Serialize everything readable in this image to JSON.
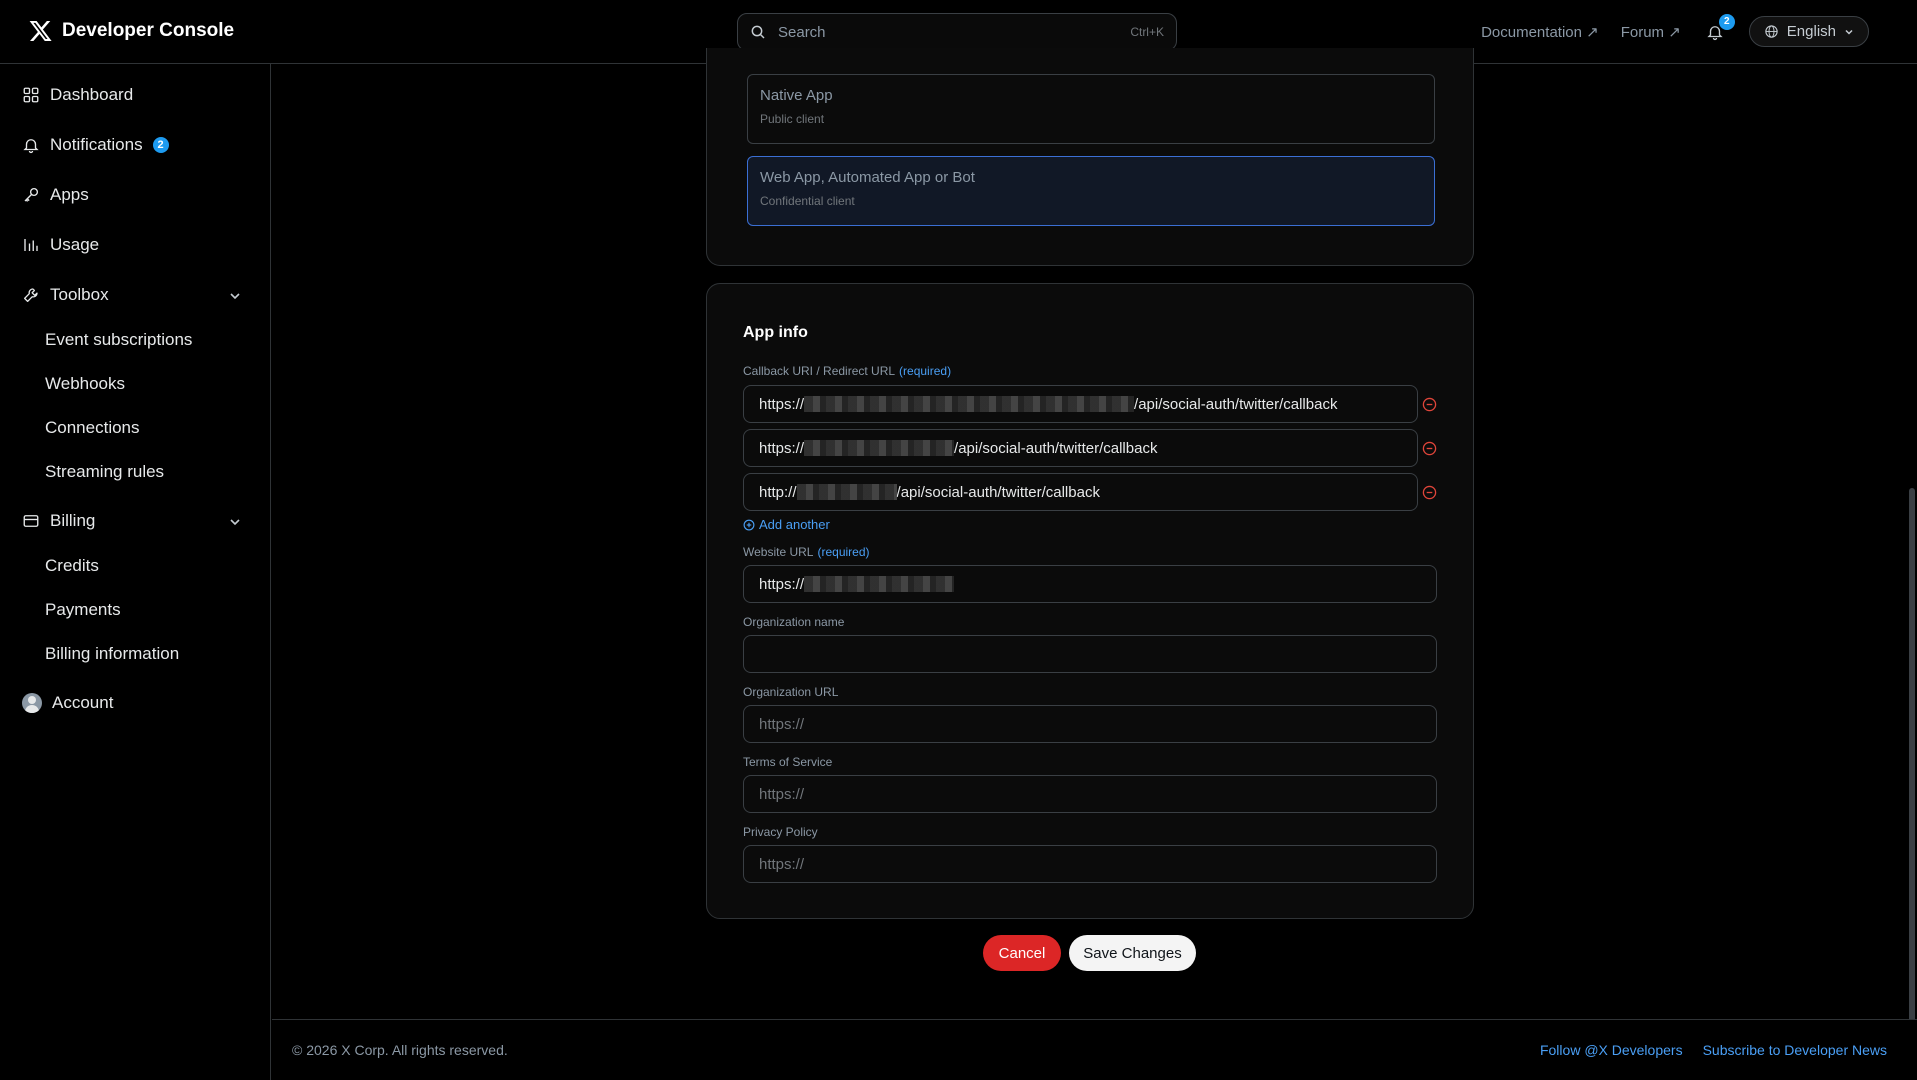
{
  "header": {
    "brand": "Developer Console",
    "search_placeholder": "Search",
    "search_shortcut": "Ctrl+K",
    "documentation": "Documentation ↗",
    "forum": "Forum ↗",
    "notification_count": "2",
    "language": "English"
  },
  "sidebar": {
    "dashboard": "Dashboard",
    "notifications": "Notifications",
    "notifications_count": "2",
    "apps": "Apps",
    "usage": "Usage",
    "toolbox": "Toolbox",
    "toolbox_items": [
      "Event subscriptions",
      "Webhooks",
      "Connections",
      "Streaming rules"
    ],
    "billing": "Billing",
    "billing_items": [
      "Credits",
      "Payments",
      "Billing information"
    ],
    "account": "Account"
  },
  "app_type": {
    "options": [
      {
        "title": "Native App",
        "subtitle": "Public client",
        "selected": false
      },
      {
        "title": "Web App, Automated App or Bot",
        "subtitle": "Confidential client",
        "selected": true
      }
    ]
  },
  "app_info": {
    "title": "App info",
    "callback_label": "Callback URI / Redirect URL",
    "required": "(required)",
    "callbacks": [
      {
        "prefix": "https://",
        "suffix": "/api/social-auth/twitter/callback"
      },
      {
        "prefix": "https://",
        "suffix": "/api/social-auth/twitter/callback"
      },
      {
        "prefix": "http://",
        "suffix": "/api/social-auth/twitter/callback"
      }
    ],
    "add_another": "Add another",
    "website_label": "Website URL",
    "website_prefix": "https://",
    "org_name_label": "Organization name",
    "org_url_label": "Organization URL",
    "org_url_placeholder": "https://",
    "tos_label": "Terms of Service",
    "tos_placeholder": "https://",
    "privacy_label": "Privacy Policy",
    "privacy_placeholder": "https://"
  },
  "actions": {
    "cancel": "Cancel",
    "save": "Save Changes"
  },
  "footer": {
    "copyright": "© 2026 X Corp. All rights reserved.",
    "follow": "Follow @X Developers",
    "subscribe": "Subscribe to Developer News"
  },
  "colors": {
    "accent": "#1d9bf0",
    "cancel": "#dc2626",
    "selected_border": "#3b6fd4"
  }
}
